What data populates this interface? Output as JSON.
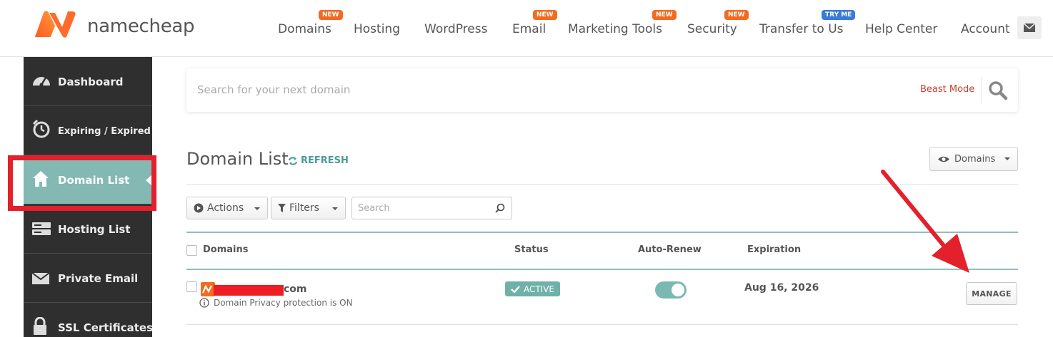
{
  "header": {
    "logo_text": "namecheap",
    "nav": [
      {
        "label": "Domains",
        "badge": "NEW"
      },
      {
        "label": "Hosting",
        "badge": ""
      },
      {
        "label": "WordPress",
        "badge": ""
      },
      {
        "label": "Email",
        "badge": "NEW"
      },
      {
        "label": "Marketing Tools",
        "badge": ""
      },
      {
        "label": "Security",
        "badge": "NEW"
      },
      {
        "label": "Transfer to Us",
        "badge": "TRY ME"
      },
      {
        "label": "Help Center",
        "badge": ""
      },
      {
        "label": "Account",
        "badge": ""
      }
    ],
    "mail_icon": "envelope-icon"
  },
  "sidebar": {
    "items": [
      {
        "label": "Dashboard",
        "icon": "gauge-icon"
      },
      {
        "label": "Expiring / Expired",
        "icon": "timer-icon"
      },
      {
        "label": "Domain List",
        "icon": "home-icon",
        "active": true
      },
      {
        "label": "Hosting List",
        "icon": "server-icon"
      },
      {
        "label": "Private Email",
        "icon": "envelope-icon"
      },
      {
        "label": "SSL Certificates",
        "icon": "lock-icon"
      }
    ]
  },
  "search": {
    "placeholder": "Search for your next domain",
    "beast_mode": "Beast Mode"
  },
  "main": {
    "title": "Domain List",
    "refresh": "REFRESH",
    "view_dropdown": "Domains",
    "actions": "Actions",
    "filters": "Filters",
    "table_search_placeholder": "Search"
  },
  "table": {
    "columns": [
      "Domains",
      "Status",
      "Auto-Renew",
      "Expiration"
    ],
    "rows": [
      {
        "domain_tld": "com",
        "privacy": "Domain Privacy protection is ON",
        "status": "ACTIVE",
        "auto_renew": true,
        "expiration": "Aug 16, 2026",
        "action": "MANAGE"
      }
    ]
  },
  "colors": {
    "brand": "#f26b21",
    "teal": "#83b8b3",
    "highlight": "#e3202b",
    "sidebar_bg": "#2f2f2f"
  }
}
